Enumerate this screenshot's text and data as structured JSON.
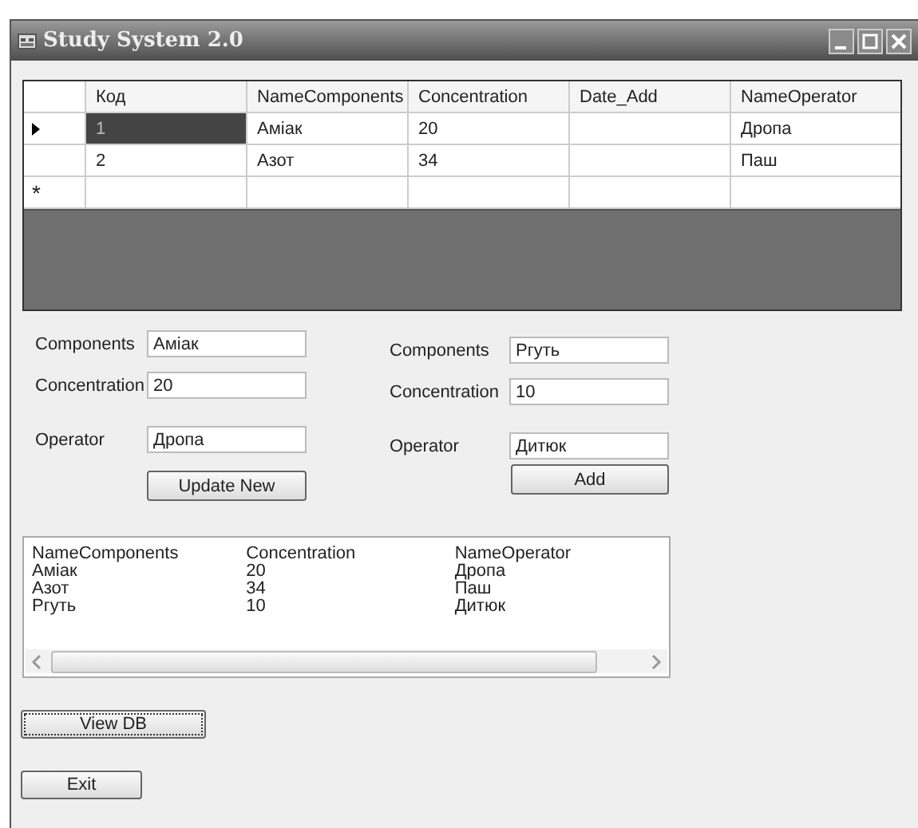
{
  "window": {
    "title": "Study System 2.0"
  },
  "grid": {
    "columns": [
      "Код",
      "NameComponents",
      "Concentration",
      "Date_Add",
      "NameOperator"
    ],
    "rows": [
      {
        "current": true,
        "cells": [
          {
            "text": "1",
            "selected": true
          },
          {
            "text": "Аміак",
            "selected": false
          },
          {
            "text": "20",
            "selected": false
          },
          {
            "text": "",
            "selected": false
          },
          {
            "text": "Дропа",
            "selected": false
          }
        ]
      },
      {
        "current": false,
        "cells": [
          {
            "text": "2",
            "selected": false
          },
          {
            "text": "Азот",
            "selected": false
          },
          {
            "text": "34",
            "selected": false
          },
          {
            "text": "",
            "selected": false
          },
          {
            "text": "Паш",
            "selected": false
          }
        ]
      }
    ],
    "new_row_marker": "*"
  },
  "update_form": {
    "fields": [
      {
        "label": "Components",
        "value": "Аміак"
      },
      {
        "label": "Concentration",
        "value": "20"
      },
      {
        "label": "Operator",
        "value": "Дропа"
      }
    ],
    "button": "Update New"
  },
  "add_form": {
    "fields": [
      {
        "label": "Components",
        "value": "Ргуть"
      },
      {
        "label": "Concentration",
        "value": "10"
      },
      {
        "label": "Operator",
        "value": "Дитюк"
      }
    ],
    "button": "Add"
  },
  "list": {
    "columns": [
      "NameComponents",
      "Concentration",
      "NameOperator"
    ],
    "rows": [
      [
        "Аміак",
        "20",
        "Дропа"
      ],
      [
        "Азот",
        "34",
        "Паш"
      ],
      [
        "Ргуть",
        "10",
        "Дитюк"
      ]
    ]
  },
  "buttons": [
    {
      "label": "View DB",
      "focused": true
    },
    {
      "label": "Exit",
      "focused": false
    }
  ]
}
